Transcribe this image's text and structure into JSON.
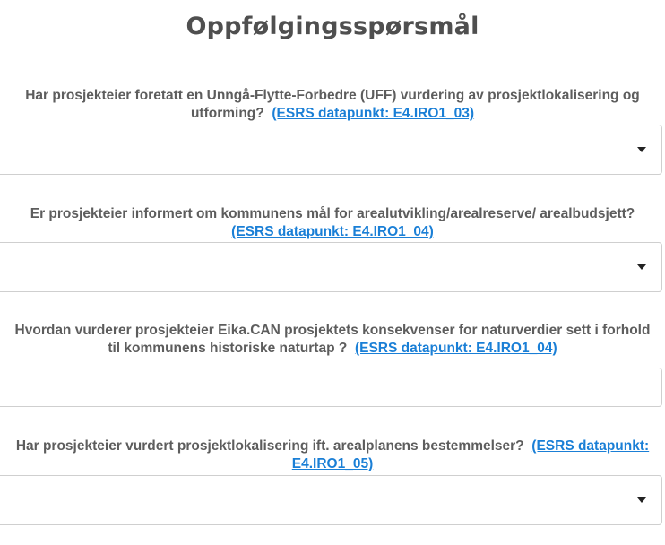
{
  "page": {
    "title": "Oppfølgingsspørsmål"
  },
  "questions": [
    {
      "text_line1": "Har prosjekteier foretatt en Unngå-Flytte-Forbedre (UFF) vurdering av prosjektlokalisering og",
      "text_line2": "utforming?",
      "link": "(ESRS datapunkt: E4.IRO1_03)",
      "field_type": "select",
      "value": ""
    },
    {
      "text_line1": "Er prosjekteier informert om kommunens mål for arealutvikling/arealreserve/ arealbudsjett?",
      "text_line2": "",
      "link": "(ESRS datapunkt: E4.IRO1_04)",
      "field_type": "select",
      "value": ""
    },
    {
      "text_line1": "Hvordan vurderer prosjekteier Eika.CAN prosjektets konsekvenser for naturverdier sett i forhold",
      "text_line2": "til kommunens historiske naturtap ?",
      "link": "(ESRS datapunkt: E4.IRO1_04)",
      "field_type": "text",
      "value": ""
    },
    {
      "text_line1": "Har prosjekteier vurdert prosjektlokalisering ift. arealplanens bestemmelser?",
      "text_line2": "",
      "link_part1": "(ESRS datapunkt:",
      "link_part2": "E4.IRO1_05)",
      "field_type": "select",
      "value": ""
    }
  ]
}
